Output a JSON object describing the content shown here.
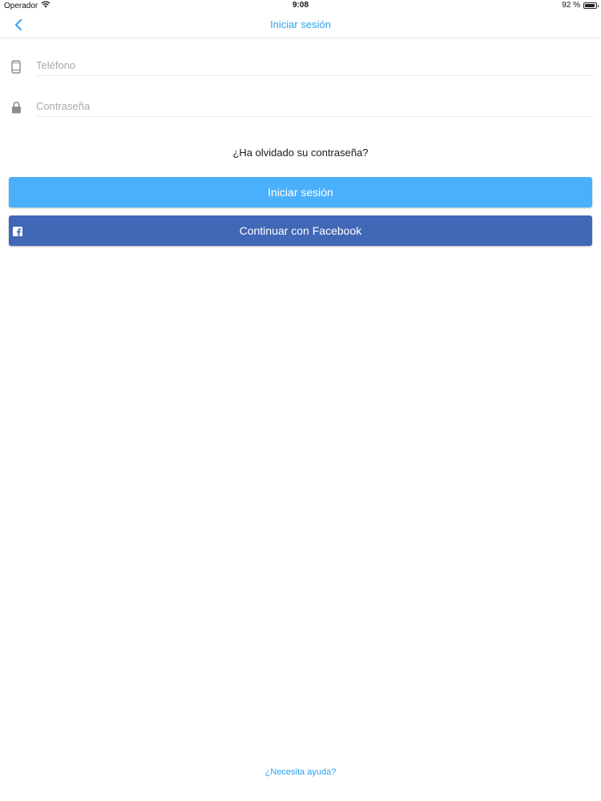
{
  "status_bar": {
    "carrier": "Operador",
    "time": "9:08",
    "battery_text": "92 %",
    "battery_level": 0.92
  },
  "nav": {
    "title": "Iniciar sesión",
    "back_icon": "chevron-left-icon"
  },
  "form": {
    "phone": {
      "placeholder": "Teléfono",
      "value": "",
      "icon": "phone-icon"
    },
    "password": {
      "placeholder": "Contraseña",
      "value": "",
      "icon": "lock-icon"
    },
    "forgot_label": "¿Ha olvidado su contraseña?",
    "login_label": "Iniciar sesión",
    "facebook_label": "Continuar con Facebook",
    "facebook_icon": "facebook-icon"
  },
  "footer": {
    "help_label": "¿Necesita ayuda?"
  },
  "colors": {
    "accent": "#2aa3ef",
    "login_button": "#4bb0fb",
    "facebook_button": "#4168b6"
  }
}
